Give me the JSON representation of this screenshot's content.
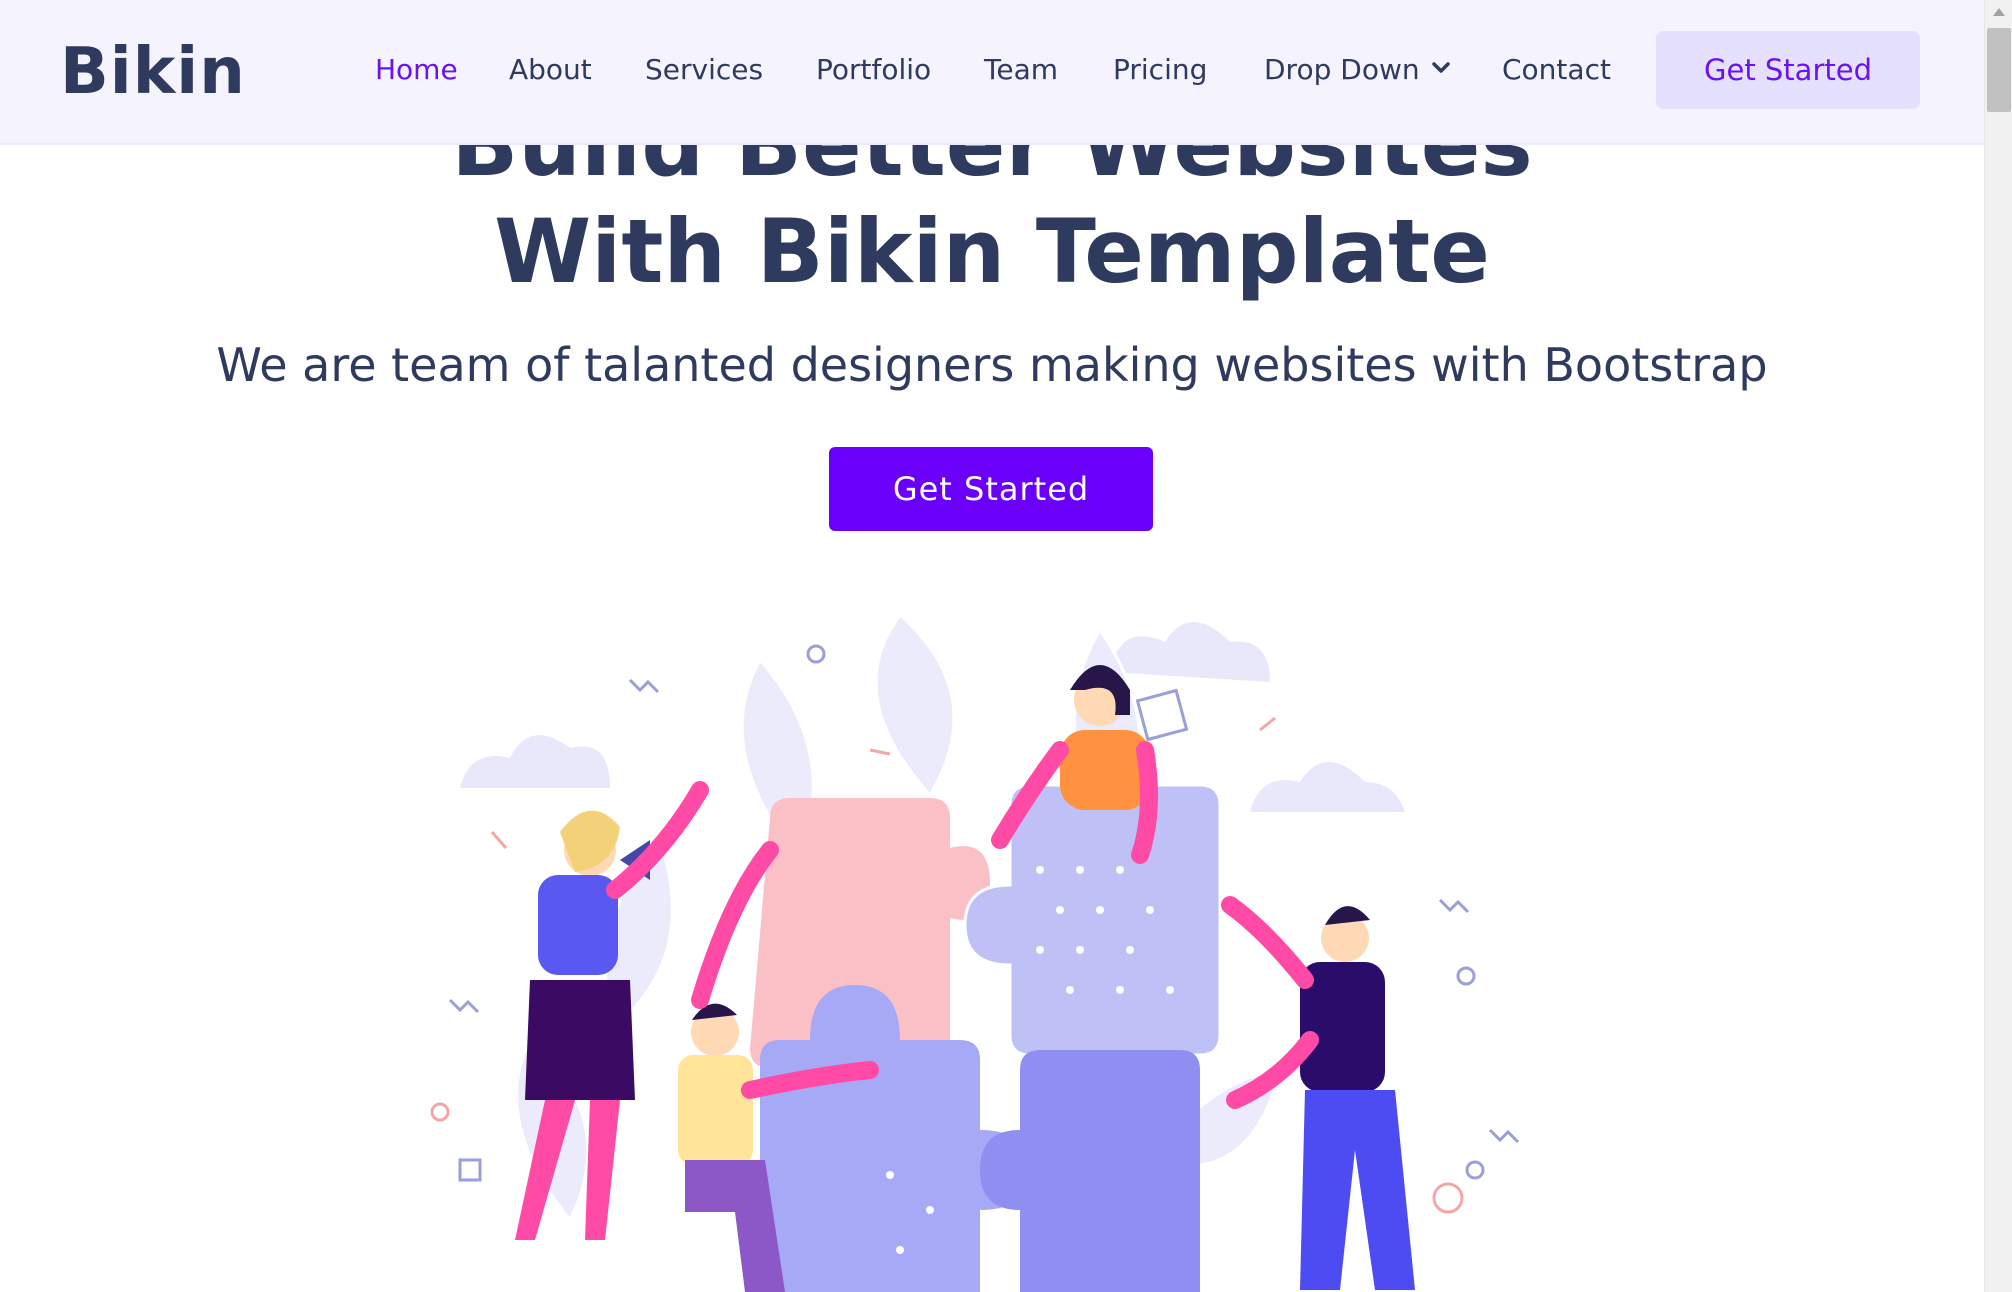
{
  "header": {
    "logo": "Bikin",
    "nav": [
      {
        "label": "Home",
        "active": true
      },
      {
        "label": "About"
      },
      {
        "label": "Services"
      },
      {
        "label": "Portfolio"
      },
      {
        "label": "Team"
      },
      {
        "label": "Pricing"
      },
      {
        "label": "Drop Down",
        "dropdown": true
      },
      {
        "label": "Contact"
      }
    ],
    "cta": "Get Started"
  },
  "hero": {
    "title_line1": "Build Better Websites",
    "title_line2": "With Bikin Template",
    "subtitle": "We are team of talanted designers making websites with Bootstrap",
    "cta": "Get Started",
    "illustration": "team-puzzle-illustration"
  },
  "colors": {
    "accent": "#6a00fb",
    "nav_active": "#6a12f5",
    "text": "#2f3a5f",
    "header_bg": "#f5f4fe",
    "header_button_bg": "#e5e0fd"
  }
}
